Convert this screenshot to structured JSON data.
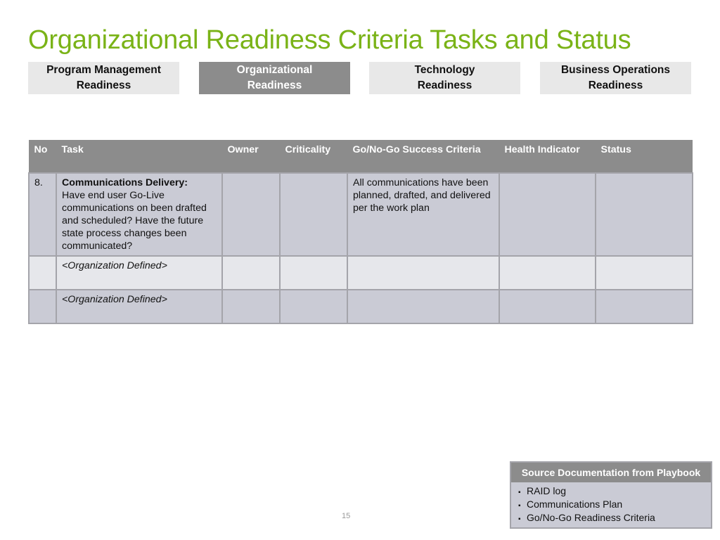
{
  "title": "Organizational Readiness Criteria Tasks and Status",
  "tabs": [
    {
      "line1": "Program Management",
      "line2": "Readiness",
      "active": false
    },
    {
      "line1": "Organizational",
      "line2": "Readiness",
      "active": true
    },
    {
      "line1": "Technology",
      "line2": "Readiness",
      "active": false
    },
    {
      "line1": "Business Operations",
      "line2": "Readiness",
      "active": false
    }
  ],
  "table": {
    "headers": [
      "No",
      "Task",
      "Owner",
      "Criticality",
      "Go/No-Go Success Criteria",
      "Health Indicator",
      "Status"
    ],
    "rows": [
      {
        "no": "8.",
        "task_title": "Communications Delivery:",
        "task_body": "Have end user Go-Live communications on been drafted and scheduled? Have the future state process changes been communicated?",
        "owner": "",
        "criticality": "",
        "criteria": "All communications have been planned, drafted, and delivered per the work plan",
        "health": "",
        "status": ""
      },
      {
        "no": "",
        "task_body": "<Organization Defined>",
        "owner": "",
        "criticality": "",
        "criteria": "",
        "health": "",
        "status": ""
      },
      {
        "no": "",
        "task_body": "<Organization Defined>",
        "owner": "",
        "criticality": "",
        "criteria": "",
        "health": "",
        "status": ""
      }
    ]
  },
  "source_documentation": {
    "heading": "Source Documentation from Playbook",
    "items": [
      "RAID log",
      "Communications Plan",
      "Go/No-Go Readiness Criteria"
    ]
  },
  "page_number": "15",
  "colors": {
    "title_green": "#7ab317",
    "header_gray": "#8c8c8c",
    "row_dark": "#cacbd5",
    "row_light": "#e6e7eb"
  }
}
